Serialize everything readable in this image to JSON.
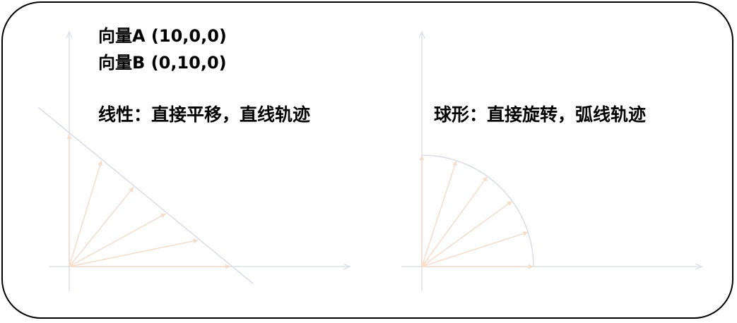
{
  "vector_a_label": "向量A (10,0,0)",
  "vector_b_label": "向量B (0,10,0)",
  "linear_caption": "线性：直接平移，直线轨迹",
  "spherical_caption": "球形：直接旋转，弧线轨迹",
  "colors": {
    "frame": "#000000",
    "axis": "#dde0ea",
    "vector": "#f5dccb",
    "trajectory": "#d9dce8",
    "text": "#000000"
  },
  "vector_a": [
    10,
    0,
    0
  ],
  "vector_b": [
    0,
    10,
    0
  ],
  "interpolation_steps": 6
}
